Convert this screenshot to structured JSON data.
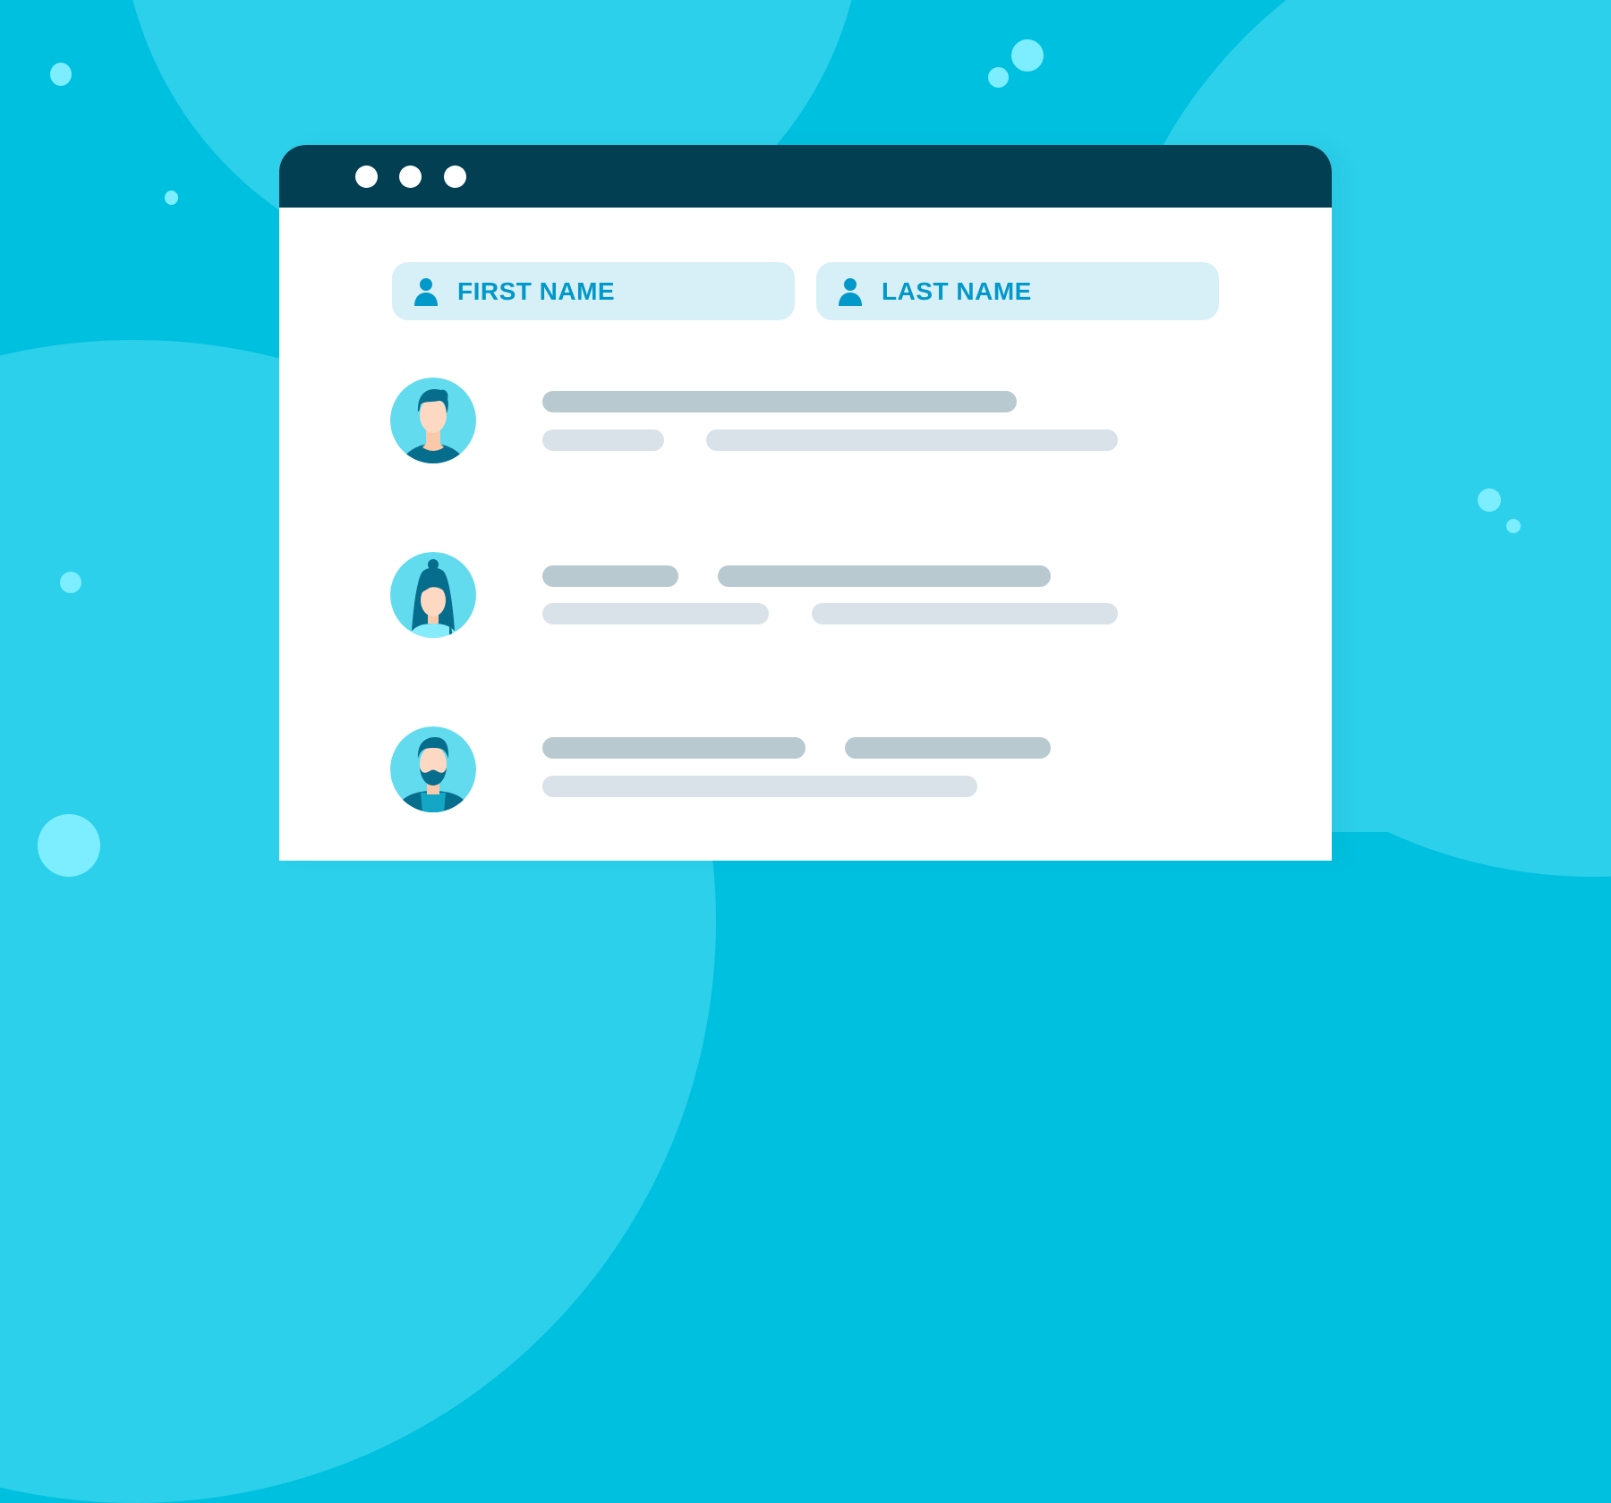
{
  "window": {
    "title_bar_dots": [
      "window-dot-1",
      "window-dot-2",
      "window-dot-3"
    ]
  },
  "form": {
    "first_name": {
      "label": "FIRST NAME",
      "icon": "user-icon"
    },
    "last_name": {
      "label": "LAST NAME",
      "icon": "user-icon"
    }
  },
  "rows": [
    {
      "avatar": "man-short-hair-avatar",
      "placeholder_lines": 2
    },
    {
      "avatar": "woman-long-hair-bun-avatar",
      "placeholder_lines": 2
    },
    {
      "avatar": "bearded-man-avatar",
      "placeholder_lines": 2
    }
  ],
  "colors": {
    "background": "#00c0df",
    "background_blob": "#2cd0ea",
    "bubble": "#7deeff",
    "title_bar": "#023f53",
    "field_bg": "#d7eff7",
    "accent": "#0298c9",
    "bar_dark": "#b8c9d0",
    "bar_light": "#d9e2e9"
  }
}
